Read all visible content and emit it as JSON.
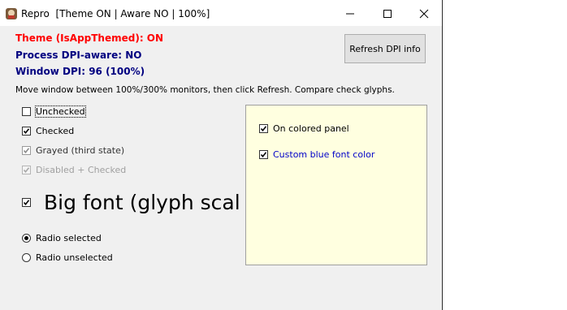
{
  "window": {
    "title": "Repro  [Theme ON | Aware NO | 100%]",
    "title_icon": "app-icon",
    "controls": {
      "minimize": "minimize-icon",
      "maximize": "maximize-icon",
      "close": "close-icon"
    }
  },
  "status": {
    "theme": "Theme (IsAppThemed): ON",
    "dpi_aware": "Process DPI-aware: NO",
    "window_dpi": "Window DPI: 96  (100%)"
  },
  "refresh_button": {
    "label": "Refresh DPI info"
  },
  "instructions": "Move window between 100%/300% monitors, then click Refresh. Compare check glyphs.",
  "checkboxes": [
    {
      "label": "Unchecked",
      "state": "unchecked"
    },
    {
      "label": "Checked",
      "state": "checked"
    },
    {
      "label": "Grayed (third state)",
      "state": "indeterminate"
    },
    {
      "label": "Disabled + Checked",
      "state": "checked-disabled"
    }
  ],
  "big_checkbox": {
    "label": "Big font (glyph scal",
    "state": "checked"
  },
  "radios": [
    {
      "label": "Radio selected",
      "selected": true
    },
    {
      "label": "Radio unselected",
      "selected": false
    }
  ],
  "panel": {
    "background": "#ffffe0",
    "checkboxes": [
      {
        "label": "On colored panel",
        "state": "checked"
      },
      {
        "label": "Custom blue font color",
        "state": "checked",
        "color": "#0000c8"
      }
    ]
  },
  "colors": {
    "theme_status": "#ff0000",
    "dpi_status": "#000080"
  }
}
